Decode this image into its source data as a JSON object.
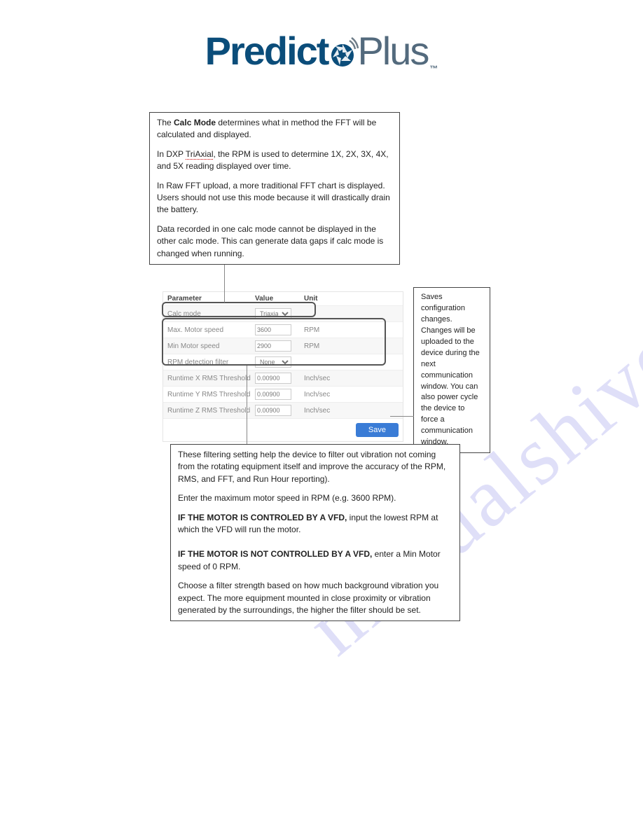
{
  "watermark": "manualshive.com",
  "logo": {
    "left": "Predict",
    "right": "Plus",
    "tm": "™"
  },
  "box_top": {
    "p1a": "The ",
    "p1b": "Calc Mode",
    "p1c": " determines what in method the FFT will be calculated and displayed.",
    "p2a": "In DXP ",
    "p2b": "TriAxial",
    "p2c": ", the RPM is used to determine 1X, 2X, 3X, 4X, and 5X reading displayed over time.",
    "p3": "In Raw FFT upload, a more traditional FFT chart is displayed.  Users should not use this mode because it will drastically drain the battery.",
    "p4": "Data recorded in one calc mode cannot be displayed in the other calc mode.  This can generate data gaps if calc mode is changed when running."
  },
  "box_right": "Saves configuration changes.  Changes will be uploaded to the device during the next communication window.  You can also power cycle the device to force a communication window.",
  "box_bottom": {
    "p1": "These filtering setting help the device to filter out vibration not coming from the rotating equipment itself and improve the accuracy of the RPM, RMS, and FFT, and Run Hour reporting).",
    "p2": "Enter the maximum motor speed in RPM (e.g. 3600 RPM).",
    "p3a": "IF THE MOTOR IS CONTROLED BY A VFD,",
    "p3b": " input the lowest RPM at which the VFD will run the motor.",
    "p4a": "IF THE MOTOR IS NOT CONTROLLED BY A VFD,",
    "p4b": " enter a Min Motor speed of 0 RPM.",
    "p5": "Choose a filter strength based on how much background vibration you expect.  The more equipment mounted in close proximity or vibration generated by the surroundings, the higher the filter should be set."
  },
  "table": {
    "headers": {
      "param": "Parameter",
      "value": "Value",
      "unit": "Unit"
    },
    "rows": [
      {
        "param": "Calc mode",
        "value": "Triaxial",
        "unit": "",
        "kind": "select"
      },
      {
        "param": "Max. Motor speed",
        "value": "3600",
        "unit": "RPM",
        "kind": "input"
      },
      {
        "param": "Min Motor speed",
        "value": "2900",
        "unit": "RPM",
        "kind": "input"
      },
      {
        "param": "RPM detection filter",
        "value": "None",
        "unit": "",
        "kind": "select"
      },
      {
        "param": "Runtime X RMS Threshold",
        "value": "0.00900",
        "unit": "Inch/sec",
        "kind": "input"
      },
      {
        "param": "Runtime Y RMS Threshold",
        "value": "0.00900",
        "unit": "Inch/sec",
        "kind": "input"
      },
      {
        "param": "Runtime Z RMS Threshold",
        "value": "0.00900",
        "unit": "Inch/sec",
        "kind": "input"
      }
    ],
    "save": "Save"
  }
}
